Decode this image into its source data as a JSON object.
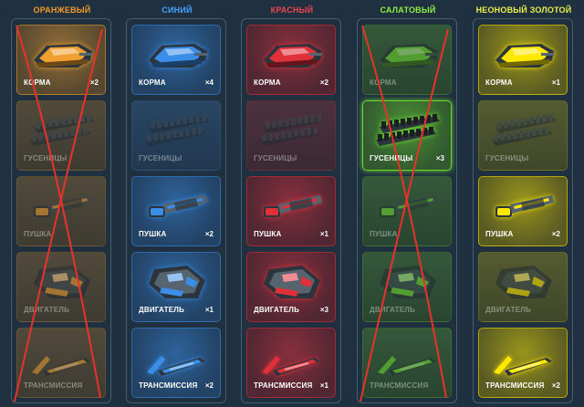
{
  "colors": {
    "background": "#1f3040",
    "cross": "#e8322b",
    "orange": "#f0a030",
    "blue": "#3a8ee8",
    "red": "#e0303a",
    "lime": "#6fe02c",
    "neon_gold": "#ffe800"
  },
  "columns": [
    {
      "title": "ОРАНЖЕВЫЙ",
      "title_color": "#f49a2a",
      "crossed": true,
      "items": [
        {
          "label": "КОРМА",
          "count": "×2",
          "owned": true,
          "icon": "hull-icon"
        },
        {
          "label": "ГУСЕНИЦЫ",
          "count": "",
          "owned": false,
          "icon": "tracks-icon"
        },
        {
          "label": "ПУШКА",
          "count": "",
          "owned": false,
          "icon": "cannon-icon"
        },
        {
          "label": "ДВИГАТЕЛЬ",
          "count": "",
          "owned": false,
          "icon": "engine-icon"
        },
        {
          "label": "ТРАНСМИССИЯ",
          "count": "",
          "owned": false,
          "icon": "transmission-icon"
        }
      ]
    },
    {
      "title": "СИНИЙ",
      "title_color": "#4aa2ff",
      "crossed": false,
      "items": [
        {
          "label": "КОРМА",
          "count": "×4",
          "owned": true,
          "icon": "hull-icon"
        },
        {
          "label": "ГУСЕНИЦЫ",
          "count": "",
          "owned": false,
          "icon": "tracks-icon"
        },
        {
          "label": "ПУШКА",
          "count": "×2",
          "owned": true,
          "icon": "cannon-icon"
        },
        {
          "label": "ДВИГАТЕЛЬ",
          "count": "×1",
          "owned": true,
          "icon": "engine-icon"
        },
        {
          "label": "ТРАНСМИССИЯ",
          "count": "×2",
          "owned": true,
          "icon": "transmission-icon"
        }
      ]
    },
    {
      "title": "КРАСНЫЙ",
      "title_color": "#f0454a",
      "crossed": false,
      "items": [
        {
          "label": "КОРМА",
          "count": "×2",
          "owned": true,
          "icon": "hull-icon"
        },
        {
          "label": "ГУСЕНИЦЫ",
          "count": "",
          "owned": false,
          "icon": "tracks-icon"
        },
        {
          "label": "ПУШКА",
          "count": "×1",
          "owned": true,
          "icon": "cannon-icon"
        },
        {
          "label": "ДВИГАТЕЛЬ",
          "count": "×3",
          "owned": true,
          "icon": "engine-icon"
        },
        {
          "label": "ТРАНСМИССИЯ",
          "count": "×1",
          "owned": true,
          "icon": "transmission-icon"
        }
      ]
    },
    {
      "title": "САЛАТОВЫЙ",
      "title_color": "#8ef043",
      "crossed": true,
      "items": [
        {
          "label": "КОРМА",
          "count": "",
          "owned": false,
          "icon": "hull-icon"
        },
        {
          "label": "ГУСЕНИЦЫ",
          "count": "×3",
          "owned": true,
          "icon": "tracks-icon"
        },
        {
          "label": "ПУШКА",
          "count": "",
          "owned": false,
          "icon": "cannon-icon"
        },
        {
          "label": "ДВИГАТЕЛЬ",
          "count": "",
          "owned": false,
          "icon": "engine-icon"
        },
        {
          "label": "ТРАНСМИССИЯ",
          "count": "",
          "owned": false,
          "icon": "transmission-icon"
        }
      ]
    },
    {
      "title": "НЕОНОВЫЙ ЗОЛОТОЙ",
      "title_color": "#e8f04a",
      "crossed": false,
      "items": [
        {
          "label": "КОРМА",
          "count": "×1",
          "owned": true,
          "icon": "hull-icon"
        },
        {
          "label": "ГУСЕНИЦЫ",
          "count": "",
          "owned": false,
          "icon": "tracks-icon"
        },
        {
          "label": "ПУШКА",
          "count": "×2",
          "owned": true,
          "icon": "cannon-icon"
        },
        {
          "label": "ДВИГАТЕЛЬ",
          "count": "",
          "owned": false,
          "icon": "engine-icon"
        },
        {
          "label": "ТРАНСМИССИЯ",
          "count": "×2",
          "owned": true,
          "icon": "transmission-icon"
        }
      ]
    }
  ]
}
